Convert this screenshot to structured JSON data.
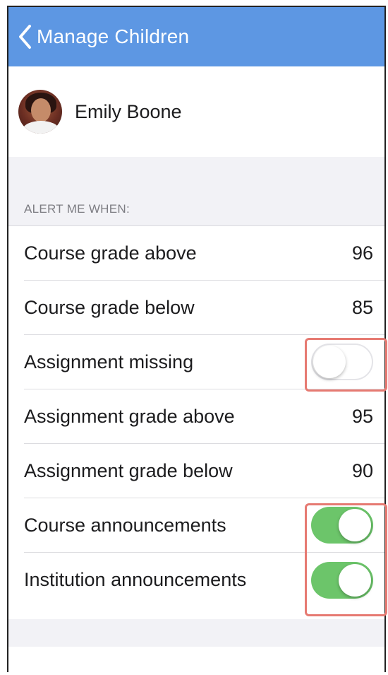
{
  "navbar": {
    "back_icon": "chevron-left-icon",
    "title": "Manage Children",
    "color": "#5d97e3"
  },
  "profile": {
    "name": "Emily Boone"
  },
  "section": {
    "header": "ALERT ME WHEN:"
  },
  "rows": [
    {
      "label": "Course grade above",
      "value": "96",
      "type": "value"
    },
    {
      "label": "Course grade below",
      "value": "85",
      "type": "value"
    },
    {
      "label": "Assignment missing",
      "type": "toggle",
      "on": false
    },
    {
      "label": "Assignment grade above",
      "value": "95",
      "type": "value"
    },
    {
      "label": "Assignment grade below",
      "value": "90",
      "type": "value"
    },
    {
      "label": "Course announcements",
      "type": "toggle",
      "on": true
    },
    {
      "label": "Institution announcements",
      "type": "toggle",
      "on": true
    }
  ],
  "colors": {
    "toggle_on": "#6cc56a",
    "highlight": "#e67a72"
  }
}
